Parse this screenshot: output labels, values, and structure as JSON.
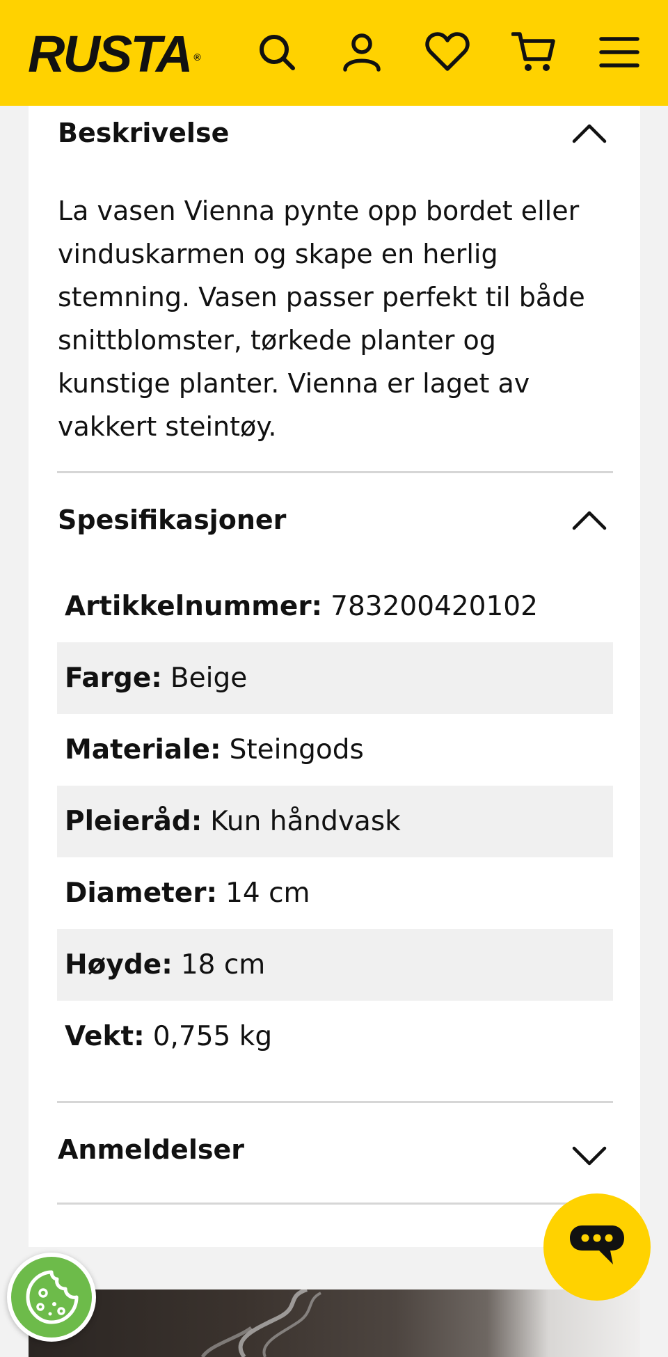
{
  "header": {
    "logo": "RUSTA",
    "icons": [
      "search-icon",
      "user-icon",
      "heart-icon",
      "cart-icon",
      "menu-icon"
    ],
    "background": "#ffd200"
  },
  "description": {
    "title": "Beskrivelse",
    "text": "La vasen Vienna pynte opp bordet eller vinduskarmen og skape en herlig stemning. Vasen passer perfekt til både snittblomster, tørkede planter og kunstige planter. Vienna er laget av vakkert steintøy."
  },
  "specifications": {
    "title": "Spesifikasjoner",
    "rows": [
      {
        "label": "Artikkelnummer:",
        "value": "783200420102"
      },
      {
        "label": "Farge:",
        "value": "Beige"
      },
      {
        "label": "Materiale:",
        "value": "Steingods"
      },
      {
        "label": "Pleieråd:",
        "value": "Kun håndvask"
      },
      {
        "label": "Diameter:",
        "value": "14 cm"
      },
      {
        "label": "Høyde:",
        "value": "18 cm"
      },
      {
        "label": "Vekt:",
        "value": "0,755 kg"
      }
    ]
  },
  "reviews": {
    "title": "Anmeldelser"
  },
  "colors": {
    "accent": "#ffd200",
    "cookie": "#6dbb4a",
    "divider": "#d6d6d6",
    "stripe": "#f0f0f0"
  }
}
